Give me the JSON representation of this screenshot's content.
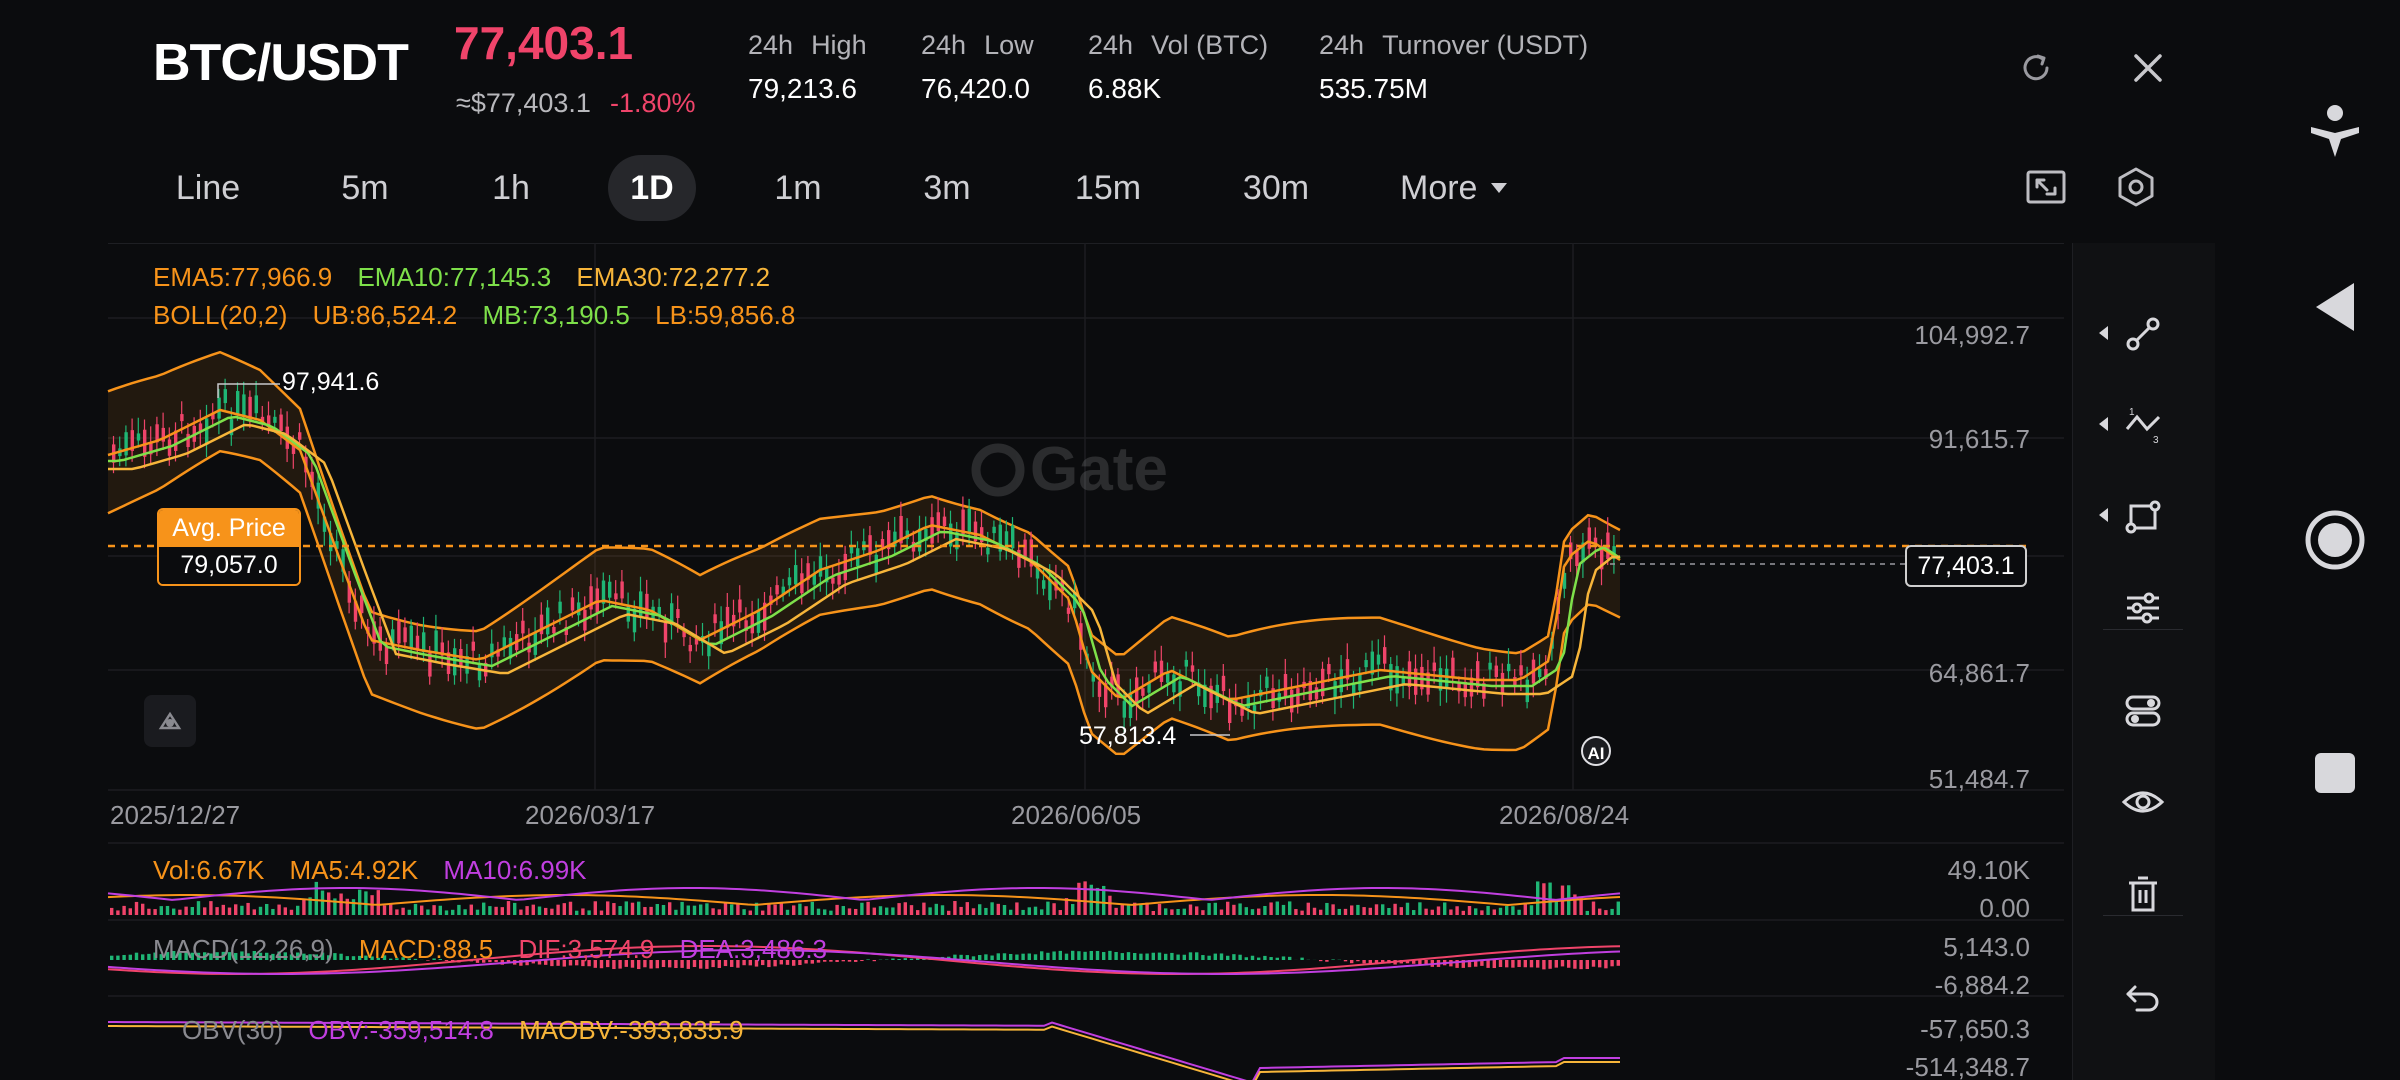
{
  "header": {
    "pair": "BTC/USDT",
    "last_price": "77,403.1",
    "usd_value": "≈$77,403.1",
    "change": "-1.80%",
    "stats": [
      {
        "k1": "24h",
        "k2": "High",
        "value": "79,213.6"
      },
      {
        "k1": "24h",
        "k2": "Low",
        "value": "76,420.0"
      },
      {
        "k1": "24h",
        "k2": "Vol (BTC)",
        "value": "6.88K"
      },
      {
        "k1": "24h",
        "k2": "Turnover (USDT)",
        "value": "535.75M"
      }
    ],
    "icons": {
      "refresh": "refresh-icon",
      "close": "close-icon"
    }
  },
  "timeframes": [
    "Line",
    "5m",
    "1h",
    "1D",
    "1m",
    "3m",
    "15m",
    "30m",
    "More"
  ],
  "active_timeframe": "1D",
  "chart_tools": {
    "fullscreen": "fullscreen-icon",
    "settings": "hexagon-settings-icon"
  },
  "indicators": {
    "ema5": "EMA5:77,966.9",
    "ema10": "EMA10:77,145.3",
    "ema30": "EMA30:72,277.2",
    "boll": "BOLL(20,2)",
    "ub": "UB:86,524.2",
    "mb": "MB:73,190.5",
    "lb": "LB:59,856.8"
  },
  "price_axis": [
    "104,992.7",
    "91,615.7",
    "64,861.7",
    "51,484.7"
  ],
  "date_axis": [
    "2025/12/27",
    "2026/03/17",
    "2026/06/05",
    "2026/08/24"
  ],
  "annotations": {
    "high": "97,941.6",
    "low": "57,813.4",
    "avg_title": "Avg. Price",
    "avg_value": "79,057.0",
    "current_price": "77,403.1",
    "watermark": "Gate",
    "ai_badge": "AI"
  },
  "volume": {
    "vol": "Vol:6.67K",
    "ma5": "MA5:4.92K",
    "ma10": "MA10:6.99K",
    "axis": [
      "49.10K",
      "0.00"
    ]
  },
  "macd": {
    "label": "MACD(12,26,9)",
    "macd": "MACD:88.5",
    "dif": "DIF:3,574.9",
    "dea": "DEA:3,486.3",
    "axis": [
      "5,143.0",
      "-6,884.2"
    ]
  },
  "obv": {
    "label": "OBV(30)",
    "obv": "OBV:-359,514.8",
    "maobv": "MAOBV:-393,835.9",
    "axis": [
      "-57,650.3",
      "-514,348.7"
    ]
  },
  "colors": {
    "up": "#1fb675",
    "down": "#f0446a",
    "ema5": "#f7931a",
    "ema10": "#7ee04a",
    "ema30": "#f7b53a",
    "purple": "#c13fe0",
    "accent": "#f7931a"
  },
  "side_tools": [
    "line-segment-icon",
    "fibonacci-icon",
    "shape-icon",
    "indicator-settings-icon",
    "toggle-settings-icon",
    "eye-icon",
    "trash-icon",
    "undo-icon"
  ],
  "system_nav": [
    "accessibility-icon",
    "back-triangle-icon",
    "home-circle-icon",
    "recents-square-icon"
  ]
}
